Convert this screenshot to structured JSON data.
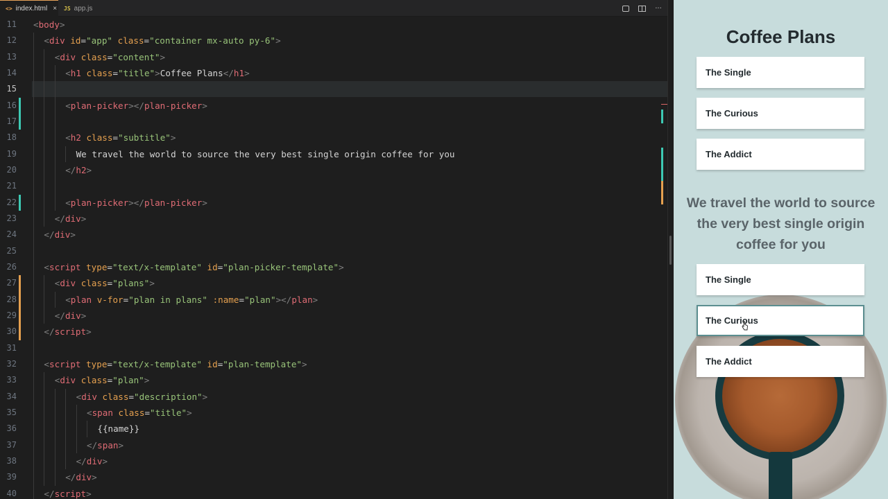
{
  "editor": {
    "tabs": [
      {
        "icon": "<>",
        "label": "index.html",
        "close": "×",
        "active": true
      },
      {
        "icon": "JS",
        "label": "app.js",
        "active": false
      }
    ],
    "actions": {
      "more": "···"
    },
    "current_line": "15",
    "lines": [
      {
        "n": "11",
        "indent": 0,
        "tokens": [
          [
            "br",
            "<"
          ],
          [
            "tag",
            "body"
          ],
          [
            "br",
            ">"
          ]
        ]
      },
      {
        "n": "12",
        "indent": 2,
        "tokens": [
          [
            "br",
            "<"
          ],
          [
            "tag",
            "div"
          ],
          [
            "tx",
            " "
          ],
          [
            "at",
            "id"
          ],
          [
            "eq",
            "="
          ],
          [
            "st",
            "\"app\""
          ],
          [
            "tx",
            " "
          ],
          [
            "at",
            "class"
          ],
          [
            "eq",
            "="
          ],
          [
            "st",
            "\"container mx-auto py-6\""
          ],
          [
            "br",
            ">"
          ]
        ]
      },
      {
        "n": "13",
        "indent": 4,
        "tokens": [
          [
            "br",
            "<"
          ],
          [
            "tag",
            "div"
          ],
          [
            "tx",
            " "
          ],
          [
            "at",
            "class"
          ],
          [
            "eq",
            "="
          ],
          [
            "st",
            "\"content\""
          ],
          [
            "br",
            ">"
          ]
        ]
      },
      {
        "n": "14",
        "indent": 6,
        "tokens": [
          [
            "br",
            "<"
          ],
          [
            "tag",
            "h1"
          ],
          [
            "tx",
            " "
          ],
          [
            "at",
            "class"
          ],
          [
            "eq",
            "="
          ],
          [
            "st",
            "\"title\""
          ],
          [
            "br",
            ">"
          ],
          [
            "tx",
            "Coffee Plans"
          ],
          [
            "br",
            "</"
          ],
          [
            "tag",
            "h1"
          ],
          [
            "br",
            ">"
          ]
        ]
      },
      {
        "n": "15",
        "indent": 0,
        "tokens": []
      },
      {
        "n": "16",
        "indent": 6,
        "tokens": [
          [
            "br",
            "<"
          ],
          [
            "tag",
            "plan-picker"
          ],
          [
            "br",
            "></"
          ],
          [
            "tag",
            "plan-picker"
          ],
          [
            "br",
            ">"
          ]
        ]
      },
      {
        "n": "17",
        "indent": 0,
        "tokens": []
      },
      {
        "n": "18",
        "indent": 6,
        "tokens": [
          [
            "br",
            "<"
          ],
          [
            "tag",
            "h2"
          ],
          [
            "tx",
            " "
          ],
          [
            "at",
            "class"
          ],
          [
            "eq",
            "="
          ],
          [
            "st",
            "\"subtitle\""
          ],
          [
            "br",
            ">"
          ]
        ]
      },
      {
        "n": "19",
        "indent": 8,
        "tokens": [
          [
            "tx",
            "We travel the world to source the very best single origin coffee for you"
          ]
        ]
      },
      {
        "n": "20",
        "indent": 6,
        "tokens": [
          [
            "br",
            "</"
          ],
          [
            "tag",
            "h2"
          ],
          [
            "br",
            ">"
          ]
        ]
      },
      {
        "n": "21",
        "indent": 0,
        "tokens": []
      },
      {
        "n": "22",
        "indent": 6,
        "tokens": [
          [
            "br",
            "<"
          ],
          [
            "tag",
            "plan-picker"
          ],
          [
            "br",
            "></"
          ],
          [
            "tag",
            "plan-picker"
          ],
          [
            "br",
            ">"
          ]
        ]
      },
      {
        "n": "23",
        "indent": 4,
        "tokens": [
          [
            "br",
            "</"
          ],
          [
            "tag",
            "div"
          ],
          [
            "br",
            ">"
          ]
        ]
      },
      {
        "n": "24",
        "indent": 2,
        "tokens": [
          [
            "br",
            "</"
          ],
          [
            "tag",
            "div"
          ],
          [
            "br",
            ">"
          ]
        ]
      },
      {
        "n": "25",
        "indent": 0,
        "tokens": []
      },
      {
        "n": "26",
        "indent": 2,
        "tokens": [
          [
            "br",
            "<"
          ],
          [
            "tag",
            "script"
          ],
          [
            "tx",
            " "
          ],
          [
            "at",
            "type"
          ],
          [
            "eq",
            "="
          ],
          [
            "st",
            "\"text/x-template\""
          ],
          [
            "tx",
            " "
          ],
          [
            "at",
            "id"
          ],
          [
            "eq",
            "="
          ],
          [
            "st",
            "\"plan-picker-template\""
          ],
          [
            "br",
            ">"
          ]
        ]
      },
      {
        "n": "27",
        "indent": 4,
        "tokens": [
          [
            "br",
            "<"
          ],
          [
            "tag",
            "div"
          ],
          [
            "tx",
            " "
          ],
          [
            "at",
            "class"
          ],
          [
            "eq",
            "="
          ],
          [
            "st",
            "\"plans\""
          ],
          [
            "br",
            ">"
          ]
        ]
      },
      {
        "n": "28",
        "indent": 6,
        "tokens": [
          [
            "br",
            "<"
          ],
          [
            "tag",
            "plan"
          ],
          [
            "tx",
            " "
          ],
          [
            "at",
            "v-for"
          ],
          [
            "eq",
            "="
          ],
          [
            "st",
            "\"plan in plans\""
          ],
          [
            "tx",
            " "
          ],
          [
            "at",
            ":name"
          ],
          [
            "eq",
            "="
          ],
          [
            "st",
            "\"plan\""
          ],
          [
            "br",
            "></"
          ],
          [
            "tag",
            "plan"
          ],
          [
            "br",
            ">"
          ]
        ]
      },
      {
        "n": "29",
        "indent": 4,
        "tokens": [
          [
            "br",
            "</"
          ],
          [
            "tag",
            "div"
          ],
          [
            "br",
            ">"
          ]
        ]
      },
      {
        "n": "30",
        "indent": 2,
        "tokens": [
          [
            "br",
            "</"
          ],
          [
            "tag",
            "script"
          ],
          [
            "br",
            ">"
          ]
        ]
      },
      {
        "n": "31",
        "indent": 0,
        "tokens": []
      },
      {
        "n": "32",
        "indent": 2,
        "tokens": [
          [
            "br",
            "<"
          ],
          [
            "tag",
            "script"
          ],
          [
            "tx",
            " "
          ],
          [
            "at",
            "type"
          ],
          [
            "eq",
            "="
          ],
          [
            "st",
            "\"text/x-template\""
          ],
          [
            "tx",
            " "
          ],
          [
            "at",
            "id"
          ],
          [
            "eq",
            "="
          ],
          [
            "st",
            "\"plan-template\""
          ],
          [
            "br",
            ">"
          ]
        ]
      },
      {
        "n": "33",
        "indent": 4,
        "tokens": [
          [
            "br",
            "<"
          ],
          [
            "tag",
            "div"
          ],
          [
            "tx",
            " "
          ],
          [
            "at",
            "class"
          ],
          [
            "eq",
            "="
          ],
          [
            "st",
            "\"plan\""
          ],
          [
            "br",
            ">"
          ]
        ]
      },
      {
        "n": "34",
        "indent": 8,
        "tokens": [
          [
            "br",
            "<"
          ],
          [
            "tag",
            "div"
          ],
          [
            "tx",
            " "
          ],
          [
            "at",
            "class"
          ],
          [
            "eq",
            "="
          ],
          [
            "st",
            "\"description\""
          ],
          [
            "br",
            ">"
          ]
        ]
      },
      {
        "n": "35",
        "indent": 10,
        "tokens": [
          [
            "br",
            "<"
          ],
          [
            "tag",
            "span"
          ],
          [
            "tx",
            " "
          ],
          [
            "at",
            "class"
          ],
          [
            "eq",
            "="
          ],
          [
            "st",
            "\"title\""
          ],
          [
            "br",
            ">"
          ]
        ]
      },
      {
        "n": "36",
        "indent": 12,
        "tokens": [
          [
            "tx",
            "{{name}}"
          ]
        ]
      },
      {
        "n": "37",
        "indent": 10,
        "tokens": [
          [
            "br",
            "</"
          ],
          [
            "tag",
            "span"
          ],
          [
            "br",
            ">"
          ]
        ]
      },
      {
        "n": "38",
        "indent": 8,
        "tokens": [
          [
            "br",
            "</"
          ],
          [
            "tag",
            "div"
          ],
          [
            "br",
            ">"
          ]
        ]
      },
      {
        "n": "39",
        "indent": 6,
        "tokens": [
          [
            "br",
            "</"
          ],
          [
            "tag",
            "div"
          ],
          [
            "br",
            ">"
          ]
        ]
      },
      {
        "n": "40",
        "indent": 2,
        "tokens": [
          [
            "br",
            "</"
          ],
          [
            "tag",
            "script"
          ],
          [
            "br",
            ">"
          ]
        ]
      }
    ],
    "colors": {
      "tag": "#e06c75",
      "attribute": "#e5a04f",
      "string": "#98c379",
      "added": "#3dc9b3",
      "modified": "#e5a04f"
    }
  },
  "preview": {
    "title": "Coffee Plans",
    "plans_top": [
      "The Single",
      "The Curious",
      "The Addict"
    ],
    "subtitle": "We travel the world to source the very best single origin coffee for you",
    "plans_bottom": [
      "The Single",
      "The Curious",
      "The Addict"
    ],
    "hovered_plan": "The Curious"
  }
}
